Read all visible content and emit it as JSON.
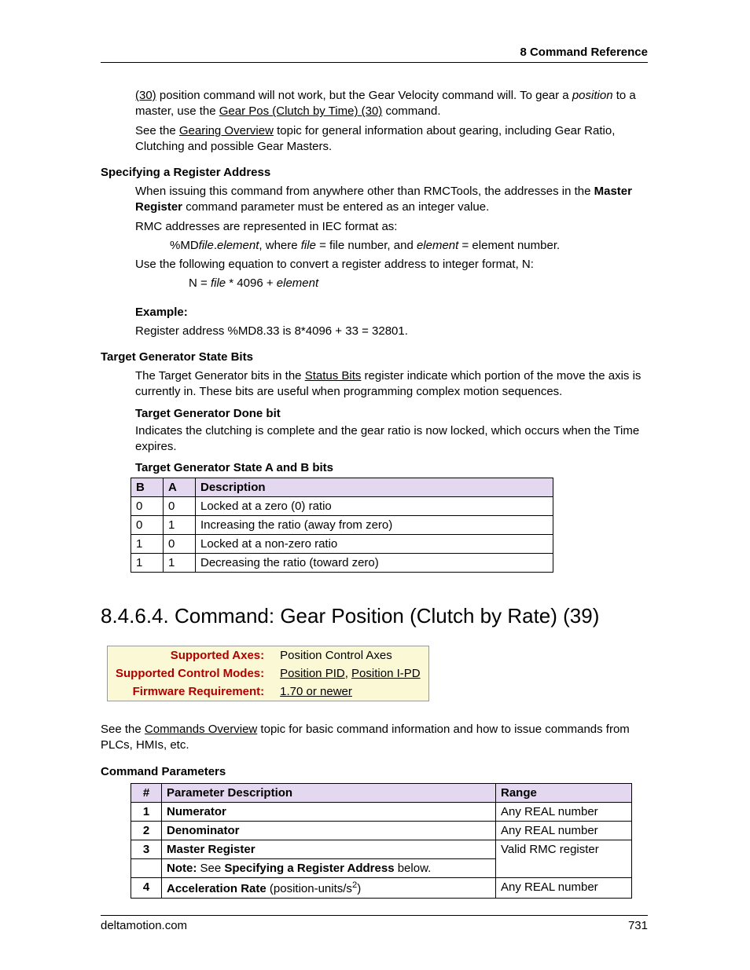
{
  "header": {
    "running": "8  Command Reference"
  },
  "intro": {
    "link30": "(30)",
    "p1_a": " position command will not work, but the Gear Velocity command will. To gear a ",
    "p1_pos": "position",
    "p1_b": " to a master, use the ",
    "p1_link": "Gear Pos (Clutch by Time) (30)",
    "p1_c": " command.",
    "p2_a": "See the ",
    "p2_link": "Gearing Overview",
    "p2_b": " topic for general information about gearing, including Gear Ratio, Clutching and possible Gear Masters."
  },
  "regaddr": {
    "title": "Specifying a Register Address",
    "p1_a": "When issuing this command from anywhere other than RMCTools, the addresses in the ",
    "p1_b": "Master Register",
    "p1_c": " command parameter must be entered as an integer value.",
    "p2": "RMC addresses are represented in IEC format as:",
    "fmt_a": "%MD",
    "fmt_file": "file",
    "fmt_dot": ".",
    "fmt_elem": "element",
    "fmt_b": ", where ",
    "fmt_file2": "file",
    "fmt_c": " = file number, and ",
    "fmt_elem2": "element",
    "fmt_d": " = element number.",
    "p3": "Use the following equation to convert a register address to integer format, N:",
    "eq_a": "N =  ",
    "eq_file": "file",
    "eq_b": " * 4096 + ",
    "eq_elem": "element",
    "ex_label": "Example:",
    "ex_body": "Register address %MD8.33 is 8*4096 + 33 = 32801."
  },
  "tgs": {
    "title": "Target Generator State Bits",
    "p1_a": "The Target Generator bits in the ",
    "p1_link": "Status Bits",
    "p1_b": " register indicate which portion of the move the axis is currently in. These bits are useful when programming complex motion sequences.",
    "done_title": "Target Generator Done bit",
    "done_body": "Indicates the clutching is complete and the gear ratio is now locked, which occurs when the Time expires.",
    "ab_title": "Target Generator State A and B bits",
    "table": {
      "headers": {
        "b": "B",
        "a": "A",
        "desc": "Description"
      },
      "rows": [
        {
          "b": "0",
          "a": "0",
          "desc": "Locked at a zero (0) ratio"
        },
        {
          "b": "0",
          "a": "1",
          "desc": "Increasing the ratio (away from zero)"
        },
        {
          "b": "1",
          "a": "0",
          "desc": "Locked at a non-zero ratio"
        },
        {
          "b": "1",
          "a": "1",
          "desc": "Decreasing the ratio (toward zero)"
        }
      ]
    }
  },
  "cmd": {
    "heading": "8.4.6.4. Command: Gear Position (Clutch by Rate) (39)",
    "info": {
      "axes_label": "Supported Axes:",
      "axes_value": "Position Control Axes",
      "modes_label": "Supported Control Modes:",
      "modes_v1": "Position PID",
      "modes_sep": ", ",
      "modes_v2": "Position I-PD",
      "fw_label": "Firmware Requirement:",
      "fw_value": "1.70 or newer"
    },
    "see_a": "See the ",
    "see_link": "Commands Overview",
    "see_b": " topic for basic command information and how to issue commands from PLCs, HMIs, etc.",
    "params_title": "Command Parameters",
    "params": {
      "headers": {
        "num": "#",
        "desc": "Parameter Description",
        "range": "Range"
      },
      "rows": [
        {
          "num": "1",
          "desc": "Numerator",
          "range": "Any REAL number",
          "bold": true
        },
        {
          "num": "2",
          "desc": "Denominator",
          "range": "Any REAL number",
          "bold": true
        },
        {
          "num": "3",
          "desc": "Master Register",
          "range": "Valid RMC register",
          "bold": true
        },
        {
          "num": "4",
          "desc_b": "Acceleration Rate",
          "desc_plain": " (position-units/s",
          "desc_sup": "2",
          "desc_end": ")",
          "range": "Any REAL number"
        }
      ],
      "note_a": "Note:",
      "note_b": " See ",
      "note_c": "Specifying a Register Address",
      "note_d": " below."
    }
  },
  "footer": {
    "site": "deltamotion.com",
    "page": "731"
  }
}
